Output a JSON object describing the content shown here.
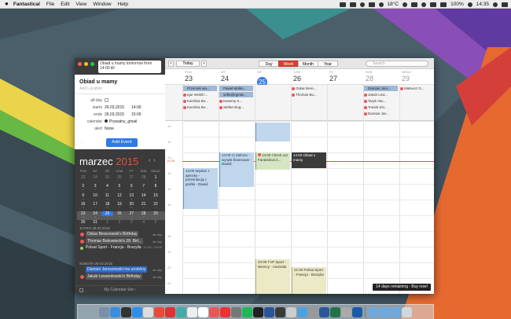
{
  "menubar": {
    "app_name": "Fantastical",
    "menus": [
      "File",
      "Edit",
      "View",
      "Window",
      "Help"
    ],
    "temperature": "18°C",
    "battery": "100%",
    "clock": "14:35"
  },
  "sidebar": {
    "nl_input": "Obiad u mamy tomorrow from 14:00 till",
    "popover": {
      "title": "Obiad u mamy",
      "location_placeholder": "Add Location",
      "all_day_label": "all-day",
      "starts_label": "starts",
      "starts_date": "26.03.2015",
      "starts_time": "14:00",
      "ends_label": "ends",
      "ends_date": "26.03.2015",
      "ends_time": "15:00",
      "calendar_label": "calendar",
      "calendar_value": "Prywatny_gmail",
      "alert_label": "alert",
      "alert_value": "None",
      "add_button": "Add Event"
    },
    "month": {
      "name": "marzec",
      "year": "2015",
      "prev": "‹",
      "next": "›"
    },
    "weekdays": [
      "PON",
      "WT",
      "ŚR",
      "CZW",
      "PT",
      "SOB",
      "NIEDZ"
    ],
    "weeks": [
      [
        "23",
        "24",
        "25",
        "26",
        "27",
        "28",
        "1"
      ],
      [
        "2",
        "3",
        "4",
        "5",
        "6",
        "7",
        "8"
      ],
      [
        "9",
        "10",
        "11",
        "12",
        "13",
        "14",
        "15"
      ],
      [
        "16",
        "17",
        "18",
        "19",
        "20",
        "21",
        "22"
      ],
      [
        "23",
        "24",
        "25",
        "26",
        "27",
        "28",
        "29"
      ],
      [
        "30",
        "31",
        "1",
        "2",
        "3",
        "4",
        "5"
      ]
    ],
    "agenda": {
      "day1_header": "JUTRO 26.03.2015",
      "day1_items": [
        {
          "title": "Oskar Berezowski's Birthday",
          "tag": "all-day"
        },
        {
          "title": "Thomas Bukowiecki's 28. Birt...",
          "tag": "all-day"
        }
      ],
      "sport_title": "Polsat Sport - Francja - Brazylia",
      "sport_time": "21:00 - 23:00",
      "day2_header": "SOBOTA 28.03.2015",
      "day2_items": [
        {
          "title": "Damian Jaroszewski ma urodziny",
          "tag": "all-day"
        },
        {
          "title": "Jakub Lewandowski's Birthday",
          "tag": "all-day"
        }
      ]
    },
    "footer": "My Calendar Set ›"
  },
  "toolbar": {
    "today": "Today",
    "prev": "‹",
    "next": "›",
    "views": [
      "Day",
      "Week",
      "Month",
      "Year"
    ],
    "search_placeholder": "Search"
  },
  "days": [
    {
      "name": "PON",
      "num": "23"
    },
    {
      "name": "WT",
      "num": "24"
    },
    {
      "name": "ŚR",
      "num": "25"
    },
    {
      "name": "CZW",
      "num": "26"
    },
    {
      "name": "PT",
      "num": "27"
    },
    {
      "name": "SOB",
      "num": "28"
    },
    {
      "name": "NIEDZ",
      "num": "29"
    }
  ],
  "allday": {
    "mon": [
      "Przemek wa...",
      "Igor Wołoh'...",
      "Karolina Bo...",
      "Karolina Bo..."
    ],
    "tue": [
      "Paweł Malko...",
      "sofie@rgmat...",
      "Kasemy K...",
      "Stefan Bog..."
    ],
    "thu": [
      "Oskar Bere...",
      "Thomas Bu..."
    ],
    "sat": [
      "Damian Jaro...",
      "Jakub Lew...",
      "Taryk Aku...",
      "Tomek Klo...",
      "Damian Jar..."
    ],
    "sun": [
      "Mateusz G..."
    ]
  },
  "hours": [
    "11",
    "12",
    "13",
    "14",
    "15",
    "16",
    "17",
    "18",
    "19",
    "20",
    "21",
    "22"
  ],
  "now_label": "14:35",
  "events": {
    "mon": "13:00 Wysłać z ajensky - prezentacją z grafiki - Dawid",
    "tue": "14:00 Ci Zalmza - wysyła finansowe - Dawid",
    "wed_a": "14:00 Check out Fantastical 2...",
    "thu": "14:00 Obiad u mamy",
    "wed_b": "20:00 TVP Sport - Niemcy - Australia",
    "thu_b": "21:00 Polsat Sport - Francja - Brazylia"
  },
  "trial": "14 days remaining - Buy now!"
}
